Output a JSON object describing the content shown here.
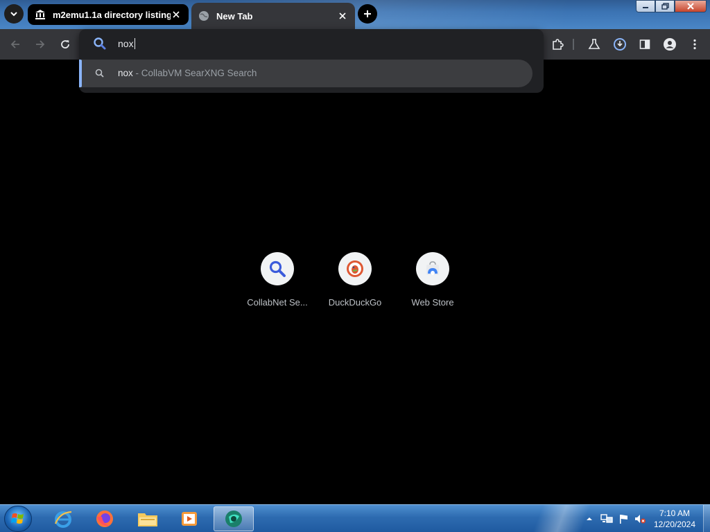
{
  "browser": {
    "tabs": [
      {
        "title": "m2emu1.1a directory listing",
        "icon": "bank-icon",
        "active": false
      },
      {
        "title": "New Tab",
        "icon": "globe-icon",
        "active": true
      }
    ],
    "omnibox": {
      "query": "nox",
      "suggestion": {
        "query": "nox",
        "provider": "- CollabVM SearXNG Search"
      }
    },
    "toolbar_icons": [
      "back-icon",
      "forward-icon",
      "reload-icon",
      "extensions-icon",
      "labs-icon",
      "download-icon",
      "side-panel-icon",
      "profile-icon",
      "menu-icon"
    ]
  },
  "shortcuts": [
    {
      "label": "CollabNet Se...",
      "icon": "search-icon"
    },
    {
      "label": "DuckDuckGo",
      "icon": "duckduckgo-icon"
    },
    {
      "label": "Web Store",
      "icon": "web-store-icon"
    }
  ],
  "taskbar": {
    "apps": [
      "internet-explorer-icon",
      "firefox-icon",
      "file-explorer-icon",
      "media-player-icon",
      "browser-icon"
    ],
    "clock": {
      "time": "7:10 AM",
      "date": "12/20/2024"
    }
  },
  "colors": {
    "tab_strip": "#3b73b3",
    "toolbar": "#35363a",
    "accent": "#8ab4f8",
    "page_bg": "#000000"
  }
}
